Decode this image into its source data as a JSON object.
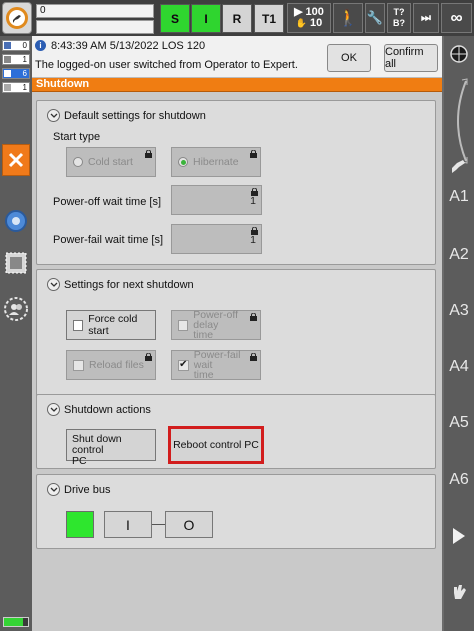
{
  "topbar": {
    "program_field": "0",
    "status_buttons": {
      "s": "S",
      "i": "I",
      "r": "R",
      "mode": "T1"
    },
    "override": "100",
    "jog_step": "10",
    "keys_label_top": "T?",
    "keys_label_bottom": "B?",
    "infinity": "∞"
  },
  "left_rail": {
    "mini_status": [
      "0",
      "1",
      "6",
      "1"
    ]
  },
  "message": {
    "header": "8:43:39 AM 5/13/2022 LOS 120",
    "text": "The logged-on user switched from Operator to Expert.",
    "ok_label": "OK",
    "confirm_all_label": "Confirm all"
  },
  "title": "Shutdown",
  "default_settings": {
    "heading": "Default settings for shutdown",
    "start_type_label": "Start type",
    "cold_start_label": "Cold start",
    "hibernate_label": "Hibernate",
    "selected": "hibernate",
    "poweroff_wait_label": "Power-off wait time [s]",
    "poweroff_wait_value": "1",
    "powerfail_wait_label": "Power-fail wait time [s]",
    "powerfail_wait_value": "1"
  },
  "next_shutdown": {
    "heading": "Settings for next shutdown",
    "force_cold_start": "Force cold start",
    "poweroff_delay_line1": "Power-off delay",
    "poweroff_delay_line2": "time",
    "reload_files": "Reload files",
    "powerfail_wait_line1": "Power-fail wait",
    "powerfail_wait_line2": "time"
  },
  "shutdown_actions": {
    "heading": "Shutdown actions",
    "shutdown_line1": "Shut down control",
    "shutdown_line2": "PC",
    "reboot": "Reboot control PC"
  },
  "drive_bus": {
    "heading": "Drive bus",
    "on_label": "I",
    "off_label": "O"
  },
  "right_rail": {
    "axes": [
      "A1",
      "A2",
      "A3",
      "A4",
      "A5",
      "A6"
    ]
  },
  "colors": {
    "accent_orange": "#f07d12",
    "status_green": "#2fd52f",
    "highlight_red": "#d21d1d"
  }
}
